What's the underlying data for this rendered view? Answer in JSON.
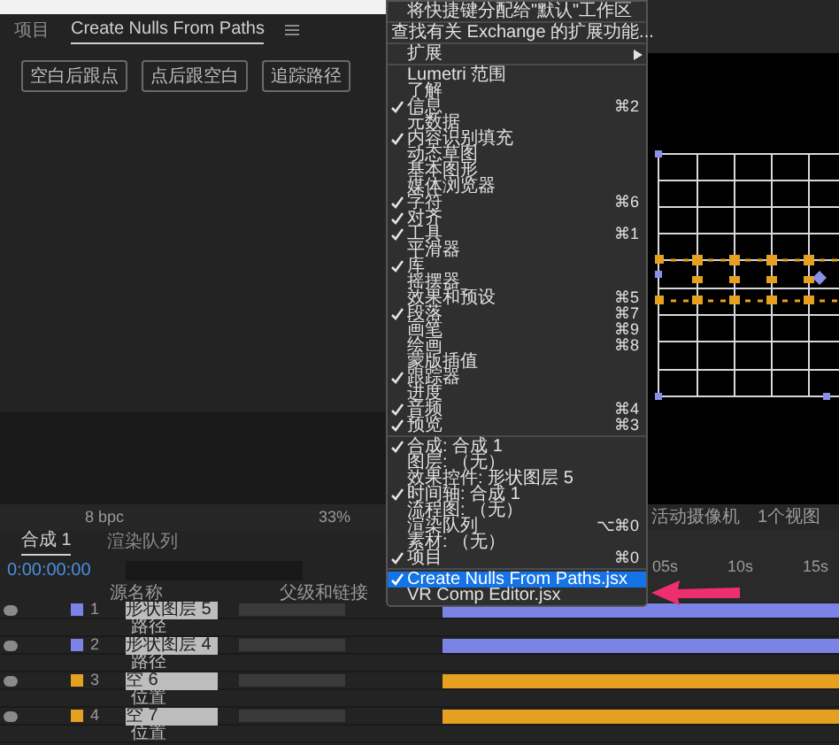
{
  "panel": {
    "tabs": [
      {
        "label": "项目",
        "selected": false
      },
      {
        "label": "Create Nulls From Paths",
        "selected": true
      }
    ],
    "buttons": [
      "空白后跟点",
      "点后跟空白",
      "追踪路径"
    ]
  },
  "viewer_toolbar": {
    "depth": "8 bpc",
    "zoom": "33%",
    "camera": "活动摄像机",
    "views": "1个视图"
  },
  "window_menu": {
    "groups": [
      [
        {
          "label": "将快捷键分配给\"默认\"工作区",
          "checked": false,
          "selected": false
        }
      ],
      [
        {
          "label": "查找有关 Exchange 的扩展功能...",
          "checked": false,
          "selected": false
        }
      ],
      [
        {
          "label": "扩展",
          "checked": false,
          "selected": false,
          "submenu": true
        }
      ],
      [
        {
          "label": "Lumetri 范围",
          "checked": false,
          "selected": false
        },
        {
          "label": "了解",
          "checked": false,
          "selected": false
        },
        {
          "label": "信息",
          "shortcut": "⌘2",
          "checked": true,
          "selected": false
        },
        {
          "label": "元数据",
          "checked": false,
          "selected": false
        },
        {
          "label": "内容识别填充",
          "checked": true,
          "selected": false
        },
        {
          "label": "动态草图",
          "checked": false,
          "selected": false
        },
        {
          "label": "基本图形",
          "checked": false,
          "selected": false
        },
        {
          "label": "媒体浏览器",
          "checked": false,
          "selected": false
        },
        {
          "label": "字符",
          "shortcut": "⌘6",
          "checked": true,
          "selected": false
        },
        {
          "label": "对齐",
          "checked": true,
          "selected": false
        },
        {
          "label": "工具",
          "shortcut": "⌘1",
          "checked": true,
          "selected": false
        },
        {
          "label": "平滑器",
          "checked": false,
          "selected": false
        },
        {
          "label": "库",
          "checked": true,
          "selected": false
        },
        {
          "label": "摇摆器",
          "checked": false,
          "selected": false
        },
        {
          "label": "效果和预设",
          "shortcut": "⌘5",
          "checked": false,
          "selected": false
        },
        {
          "label": "段落",
          "shortcut": "⌘7",
          "checked": true,
          "selected": false
        },
        {
          "label": "画笔",
          "shortcut": "⌘9",
          "checked": false,
          "selected": false
        },
        {
          "label": "绘画",
          "shortcut": "⌘8",
          "checked": false,
          "selected": false
        },
        {
          "label": "蒙版插值",
          "checked": false,
          "selected": false
        },
        {
          "label": "跟踪器",
          "checked": true,
          "selected": false
        },
        {
          "label": "进度",
          "checked": false,
          "selected": false
        },
        {
          "label": "音频",
          "shortcut": "⌘4",
          "checked": true,
          "selected": false
        },
        {
          "label": "预览",
          "shortcut": "⌘3",
          "checked": true,
          "selected": false
        }
      ],
      [
        {
          "label": "合成: 合成 1",
          "checked": true,
          "selected": false
        },
        {
          "label": "图层: （无）",
          "checked": false,
          "selected": false
        },
        {
          "label": "效果控件: 形状图层 5",
          "checked": false,
          "selected": false
        },
        {
          "label": "时间轴: 合成 1",
          "checked": true,
          "selected": false
        },
        {
          "label": "流程图: （无）",
          "checked": false,
          "selected": false
        },
        {
          "label": "渲染队列",
          "shortcut": "⌥⌘0",
          "checked": false,
          "selected": false
        },
        {
          "label": "素材: （无）",
          "checked": false,
          "selected": false
        },
        {
          "label": "项目",
          "shortcut": "⌘0",
          "checked": true,
          "selected": false
        }
      ],
      [
        {
          "label": "Create Nulls From Paths.jsx",
          "checked": true,
          "selected": true
        },
        {
          "label": "VR Comp Editor.jsx",
          "checked": false,
          "selected": false
        }
      ]
    ]
  },
  "timeline": {
    "tabs": [
      {
        "label": "合成 1",
        "selected": true
      },
      {
        "label": "渲染队列",
        "selected": false
      }
    ],
    "timecode": "0:00:00:00",
    "columns": [
      "源名称",
      "父级和链接"
    ],
    "ruler": [
      "05s",
      "10s",
      "15s"
    ],
    "rows": [
      {
        "kind": "layer",
        "number": "1",
        "name": "形状图层 5",
        "color": "#7b83e6"
      },
      {
        "kind": "property",
        "name": "路径"
      },
      {
        "kind": "layer",
        "number": "2",
        "name": "形状图层 4",
        "color": "#7b83e6"
      },
      {
        "kind": "property",
        "name": "路径"
      },
      {
        "kind": "layer",
        "number": "3",
        "name": "空 6",
        "color": "#e6a020"
      },
      {
        "kind": "property",
        "name": "位置"
      },
      {
        "kind": "layer",
        "number": "4",
        "name": "空 7",
        "color": "#e6a020"
      },
      {
        "kind": "property",
        "name": "位置"
      }
    ]
  }
}
